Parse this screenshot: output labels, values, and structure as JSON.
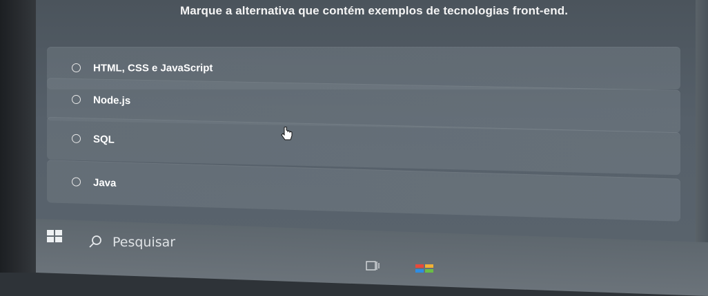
{
  "quiz": {
    "question": "Marque a alternativa que contém exemplos de tecnologias front-end.",
    "options": [
      {
        "label": "HTML, CSS e JavaScript"
      },
      {
        "label": "Node.js"
      },
      {
        "label": "SQL"
      },
      {
        "label": "Java"
      }
    ]
  },
  "taskbar": {
    "search_placeholder": "Pesquisar",
    "icons": [
      "windows-start-icon",
      "search-icon",
      "task-view-icon",
      "microsoft-store-icon"
    ]
  }
}
